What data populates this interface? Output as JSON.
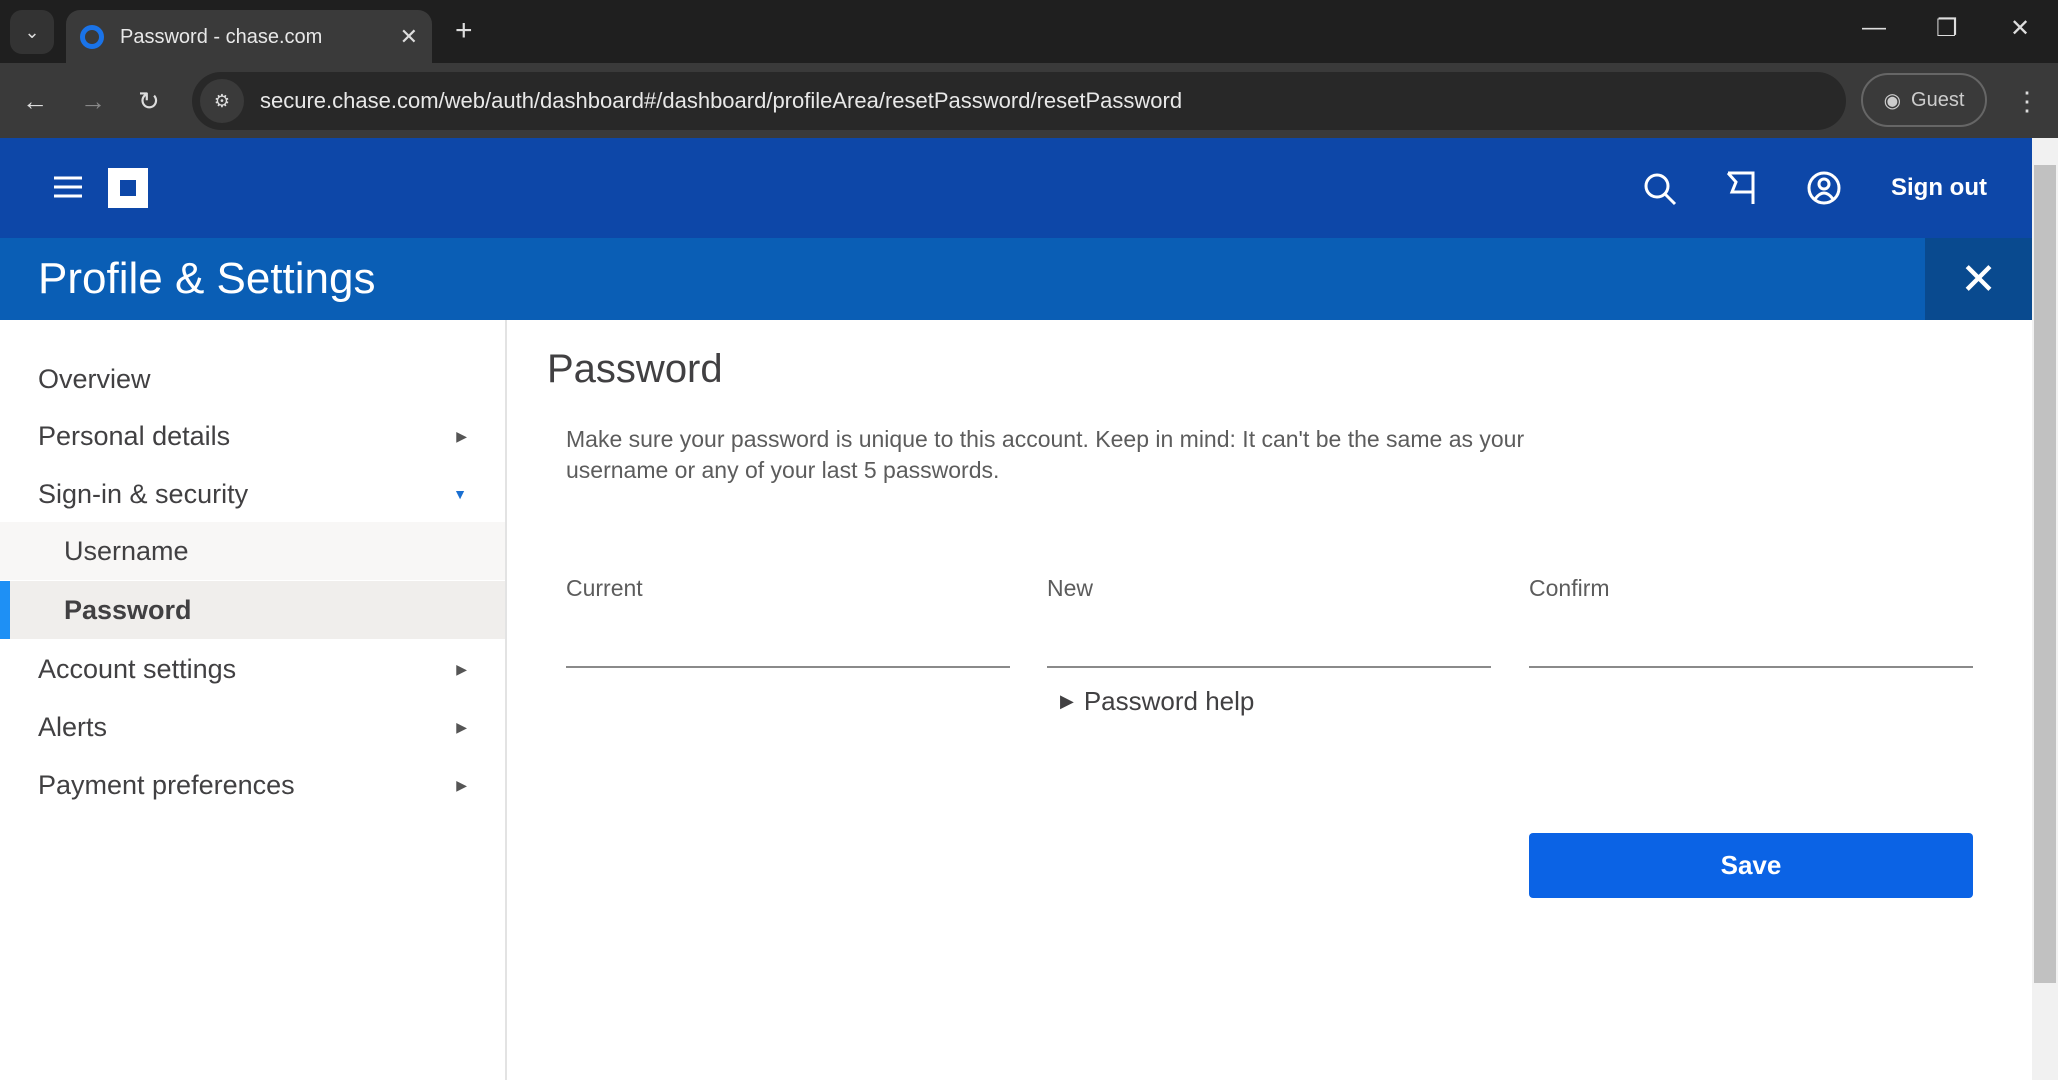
{
  "browser": {
    "tab_title": "Password - chase.com",
    "url": "secure.chase.com/web/auth/dashboard#/dashboard/profileArea/resetPassword/resetPassword",
    "profile": "Guest"
  },
  "header": {
    "sign_out": "Sign out",
    "brand_color": "#0d47a8"
  },
  "page": {
    "title": "Profile & Settings"
  },
  "sidebar": {
    "items": [
      {
        "label": "Overview"
      },
      {
        "label": "Personal details"
      },
      {
        "label": "Sign-in & security"
      },
      {
        "label": "Username"
      },
      {
        "label": "Password"
      },
      {
        "label": "Account settings"
      },
      {
        "label": "Alerts"
      },
      {
        "label": "Payment preferences"
      }
    ],
    "active": "Password"
  },
  "main": {
    "title": "Password",
    "description": "Make sure your password is unique to this account. Keep in mind: It can't be the same as your username or any of your last 5 passwords.",
    "fields": {
      "current": "Current",
      "new": "New",
      "confirm": "Confirm"
    },
    "password_help": "Password help",
    "save": "Save",
    "save_color": "#0b63e5"
  }
}
